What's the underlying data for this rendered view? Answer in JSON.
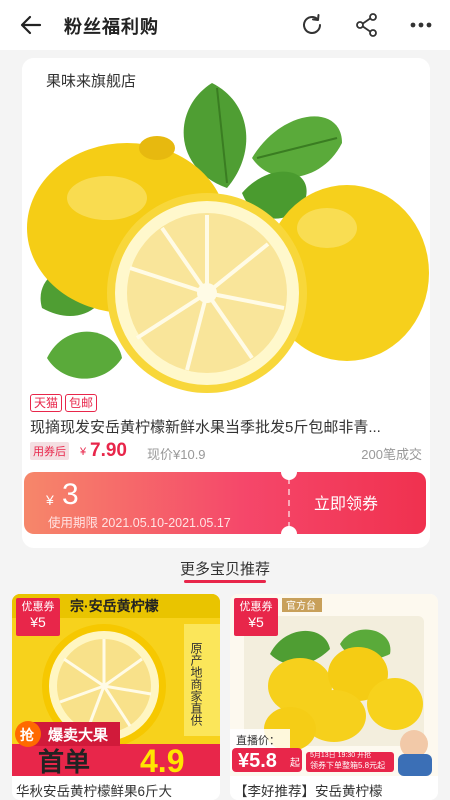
{
  "header": {
    "title": "粉丝福利购"
  },
  "store": {
    "name": "果味来旗舰店"
  },
  "product": {
    "tags": [
      "天猫",
      "包邮"
    ],
    "title": "现摘现发安岳黄柠檬新鲜水果当季批发5斤包邮非青...",
    "coupon_badge": "用券后",
    "currency": "¥",
    "price": "7.90",
    "original_price": "现价¥10.9",
    "sold": "200笔成交"
  },
  "coupon": {
    "currency": "¥",
    "value": "3",
    "validity": "使用期限 2021.05.10-2021.05.17",
    "claim_label": "立即领券"
  },
  "section": {
    "title": "更多宝贝推荐"
  },
  "recommendations": [
    {
      "badge_label": "优惠券",
      "badge_value": "¥5",
      "title": "华秋安岳黄柠檬鲜果6斤大",
      "banner_top": "宗·安岳黄柠檬",
      "side_text": "原产地商家直供",
      "bottom_tag": "抢",
      "bottom_label": "爆卖大果",
      "bottom_word": "首单",
      "bottom_price": "4.9"
    },
    {
      "badge_label": "优惠券",
      "badge_value": "¥5",
      "title": "【李好推荐】安岳黄柠檬",
      "corner_label": "官方台",
      "live_label": "直播价：",
      "live_price": "¥5.8",
      "live_suffix": "起",
      "promo_line1": "5月13日 19:30 开抢",
      "promo_line2": "领券下单整箱5.8元起"
    }
  ],
  "colors": {
    "accent": "#e8264a",
    "lemon": "#f7d21c",
    "leaf": "#4a9b2f"
  }
}
